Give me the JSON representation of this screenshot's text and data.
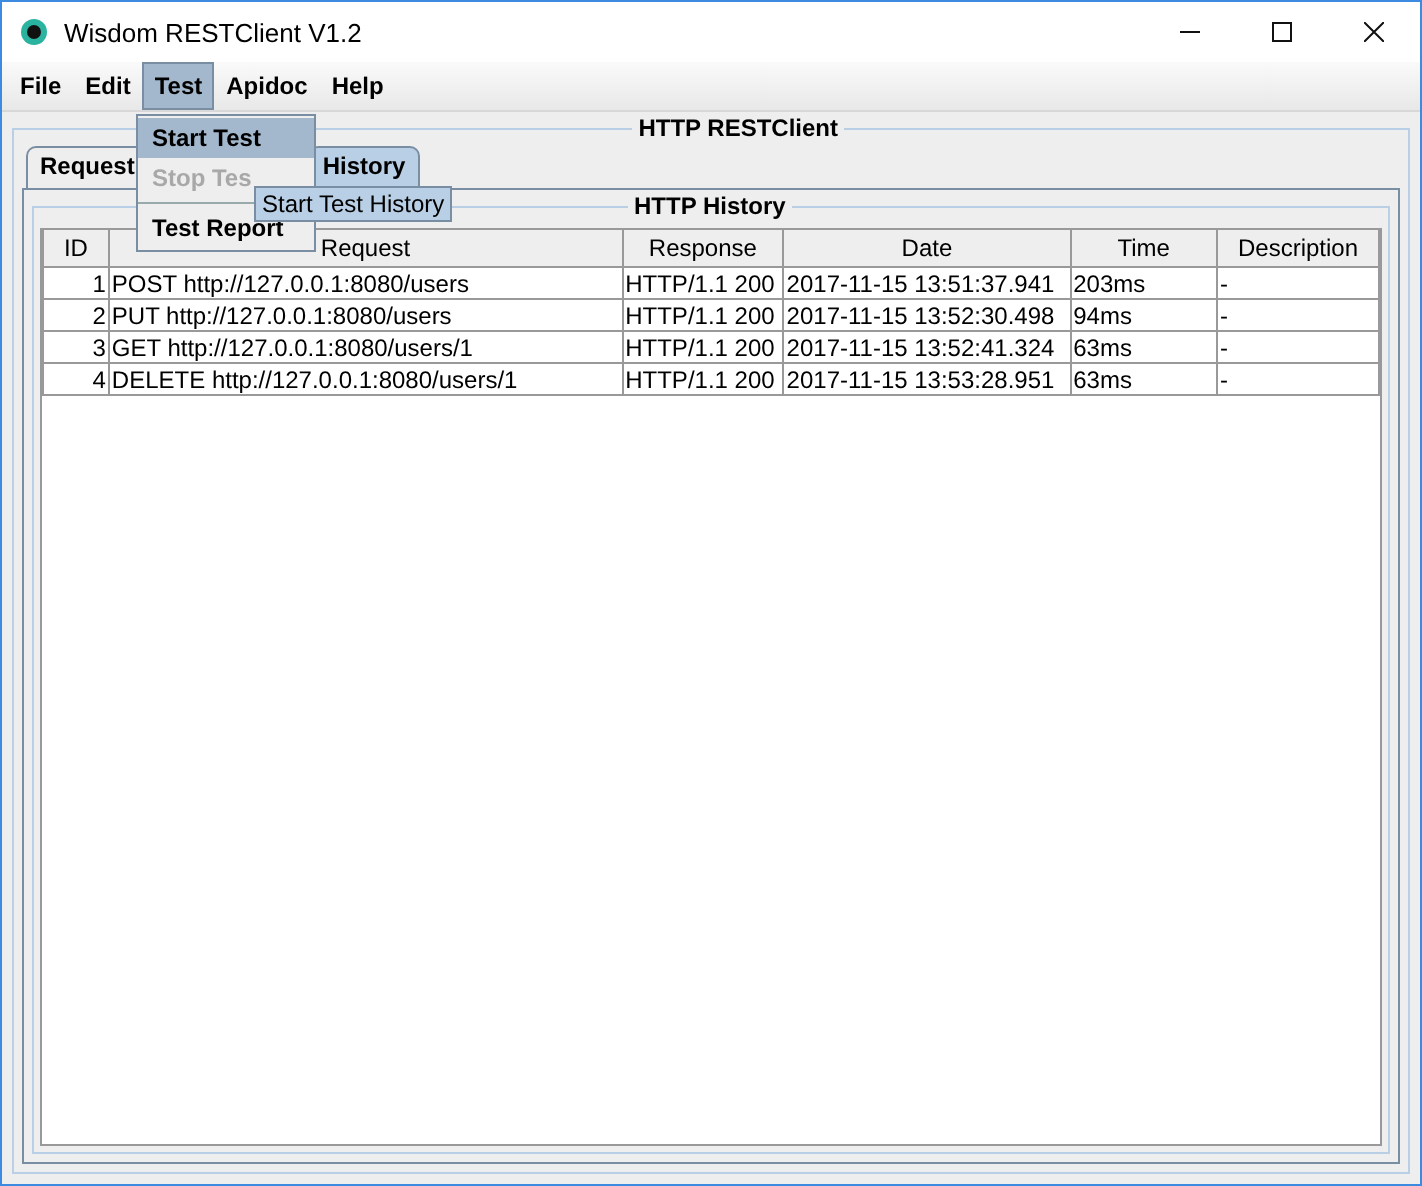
{
  "window": {
    "title": "Wisdom RESTClient V1.2"
  },
  "menu": [
    {
      "label": "File",
      "selected": false
    },
    {
      "label": "Edit",
      "selected": false
    },
    {
      "label": "Test",
      "selected": true
    },
    {
      "label": "Apidoc",
      "selected": false
    },
    {
      "label": "Help",
      "selected": false
    }
  ],
  "dropdown": [
    {
      "kind": "item",
      "label": "Start Test",
      "selected": true,
      "disabled": false
    },
    {
      "kind": "item",
      "label": "Stop Tes",
      "selected": false,
      "disabled": true
    },
    {
      "kind": "separator"
    },
    {
      "kind": "item",
      "label": "Test Report",
      "selected": false,
      "disabled": false
    }
  ],
  "tooltip": "Start Test History",
  "panel_title": "HTTP RESTClient",
  "tabs": [
    {
      "label": "Request",
      "selected": false
    },
    {
      "label": "History",
      "selected": true
    }
  ],
  "history": {
    "title": "HTTP History",
    "columns": [
      "ID",
      "Request",
      "Response",
      "Date",
      "Time",
      "Description"
    ],
    "rows": [
      [
        "1",
        "POST http://127.0.0.1:8080/users",
        "HTTP/1.1 200",
        "2017-11-15 13:51:37.941",
        "203ms",
        "-"
      ],
      [
        "2",
        "PUT http://127.0.0.1:8080/users",
        "HTTP/1.1 200",
        "2017-11-15 13:52:30.498",
        "94ms",
        "-"
      ],
      [
        "3",
        "GET http://127.0.0.1:8080/users/1",
        "HTTP/1.1 200",
        "2017-11-15 13:52:41.324",
        "63ms",
        "-"
      ],
      [
        "4",
        "DELETE http://127.0.0.1:8080/users/1",
        "HTTP/1.1 200",
        "2017-11-15 13:53:28.951",
        "63ms",
        "-"
      ]
    ]
  }
}
